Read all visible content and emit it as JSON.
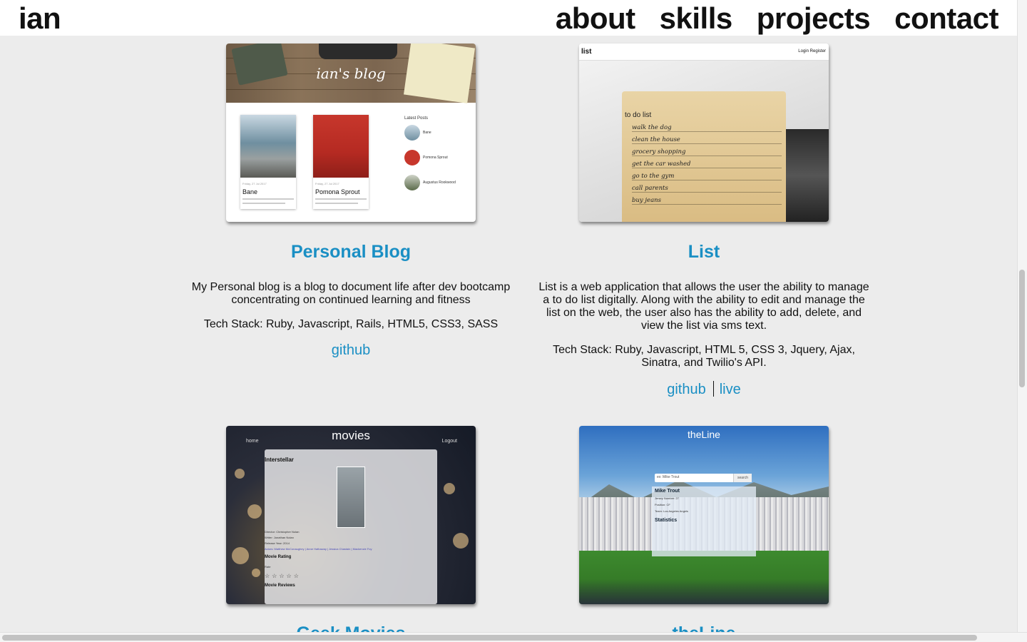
{
  "header": {
    "brand": "ian",
    "nav": [
      "about",
      "skills",
      "projects",
      "contact"
    ]
  },
  "projects": [
    {
      "title": "Personal Blog",
      "description": "My Personal blog is a blog to document life after dev bootcamp concentrating on continued learning and fitness",
      "tech_stack": "Tech Stack: Ruby, Javascript, Rails, HTML5, CSS3, SASS",
      "links": [
        "github"
      ],
      "screenshot": {
        "logo": "ian's blog",
        "posts": [
          "Bane",
          "Pomona Sprout"
        ],
        "latest_label": "Latest Posts",
        "latest": [
          "Bane",
          "Pomona Sprout",
          "Augustus Rookwood"
        ]
      }
    },
    {
      "title": "List",
      "description": "List is a web application that allows the user the ability to manage a to do list digitally. Along with the ability to edit and manage the list on the web, the user also has the ability to add, delete, and view the list via sms text.",
      "tech_stack": "Tech Stack: Ruby, Javascript, HTML 5, CSS 3, Jquery, Ajax, Sinatra, and Twilio's API.",
      "links": [
        "github",
        "live"
      ],
      "screenshot": {
        "app_name": "list",
        "top_right": "Login   Register",
        "heading": "to do list",
        "items": [
          "walk the dog",
          "clean the house",
          "grocery shopping",
          "get the car washed",
          "go to the gym",
          "call parents",
          "buy jeans"
        ]
      }
    },
    {
      "title": "Geek Movies",
      "screenshot": {
        "home": "home",
        "logo": "movies",
        "logout": "Logout",
        "movie": "Interstellar",
        "director": "Director: Christopher Nolan",
        "writer": "Writer: Jonathan Nolan",
        "year": "Release Year: 2014",
        "cast": "Actors: Matthew McConaughey | Anne Hathaway | Jessica Chastain | Mackenzie Foy",
        "rating_label": "Movie Rating",
        "rate": "Rate",
        "stars": "☆☆☆☆☆",
        "reviews_label": "Movie Reviews"
      }
    },
    {
      "title": "theLine",
      "screenshot": {
        "logo": "theLine",
        "search_placeholder": "ex: Mike Trout",
        "search_button": "search",
        "player": "Mike Trout",
        "rows": [
          "Jersey Number: 27",
          "Position: CF",
          "Team: Los Angeles Angels"
        ],
        "stats_label": "Statistics"
      }
    }
  ]
}
